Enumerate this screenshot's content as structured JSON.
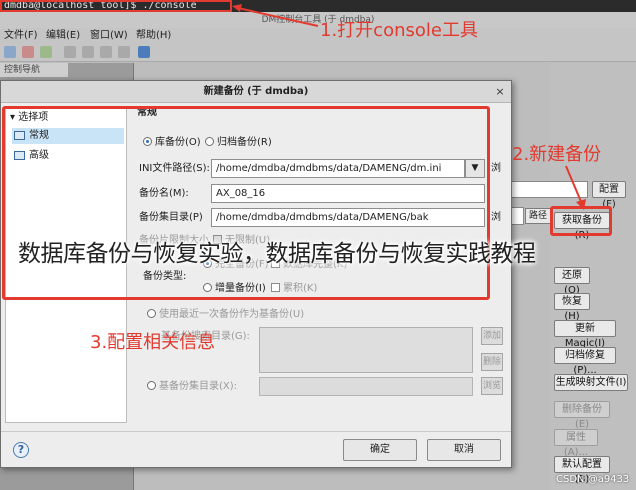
{
  "terminal": {
    "command": "dmdba@localhost tool]$ ./console"
  },
  "window": {
    "title": "DM控制台工具 (于 dmdba)",
    "menu": [
      "文件(F)",
      "编辑(E)",
      "窗口(W)",
      "帮助(H)"
    ],
    "nav_tab": "控制导航"
  },
  "right_panel": {
    "config_button": "配置(F)",
    "path_button": "路径",
    "buttons": [
      {
        "label": "获取备份(R)",
        "enabled": true
      },
      {
        "label": "还原(O)",
        "enabled": true
      },
      {
        "label": "恢复(H)",
        "enabled": true
      },
      {
        "label": "更新Magic(I)",
        "enabled": true
      },
      {
        "label": "归档修复(P)...",
        "enabled": true
      },
      {
        "label": "生成映射文件(I)",
        "enabled": true
      },
      {
        "label": "删除备份(E)",
        "enabled": false
      },
      {
        "label": "属性(A)...",
        "enabled": false
      },
      {
        "label": "默认配置(B)",
        "enabled": true
      }
    ]
  },
  "dialog": {
    "title": "新建备份 (于 dmdba)",
    "close_icon": "×",
    "tree": {
      "root": "选择项",
      "items": [
        "常规",
        "高级"
      ]
    },
    "section": "常规",
    "backup_kind": {
      "option1": "库备份(O)",
      "option2": "归档备份(R)"
    },
    "ini_label": "INI文件路径(S):",
    "ini_value": "/home/dmdba/dmdbms/data/DAMENG/dm.ini",
    "ini_side": "浏",
    "name_label": "备份名(M):",
    "name_value": "AX_08_16",
    "dir_label": "备份集目录(P)",
    "dir_value": "/home/dmdba/dmdbms/data/DAMENG/bak",
    "dir_side": "浏",
    "size_limit_label": "备份片限制大小",
    "size_unlimited": "无限制(U)",
    "type_label": "备份类型:",
    "type_full": "完全备份(F)",
    "type_consistency": "数据库完整(K)",
    "type_incremental": "增量备份(I)",
    "type_cumulative": "累积(K)",
    "use_last_label": "使用最近一次备份作为基备份(U)",
    "base_dir_list_label": "基备份搜索目录(G):",
    "add_button": "添加",
    "remove_button": "删除",
    "base_dir_label": "基备份集目录(X):",
    "browse_button": "浏览",
    "ok": "确定",
    "cancel": "取消",
    "help_icon": "?"
  },
  "annotations": {
    "step1": "1.打开console工具",
    "step2": "2.新建备份",
    "step3": "3.配置相关信息"
  },
  "overlay_caption": "数据库备份与恢复实验，数据库备份与恢复实践教程",
  "watermark": "CSDN @a9433",
  "colors": {
    "annotation_red": "#e23a2f",
    "selection_blue": "#c9e3f7"
  }
}
